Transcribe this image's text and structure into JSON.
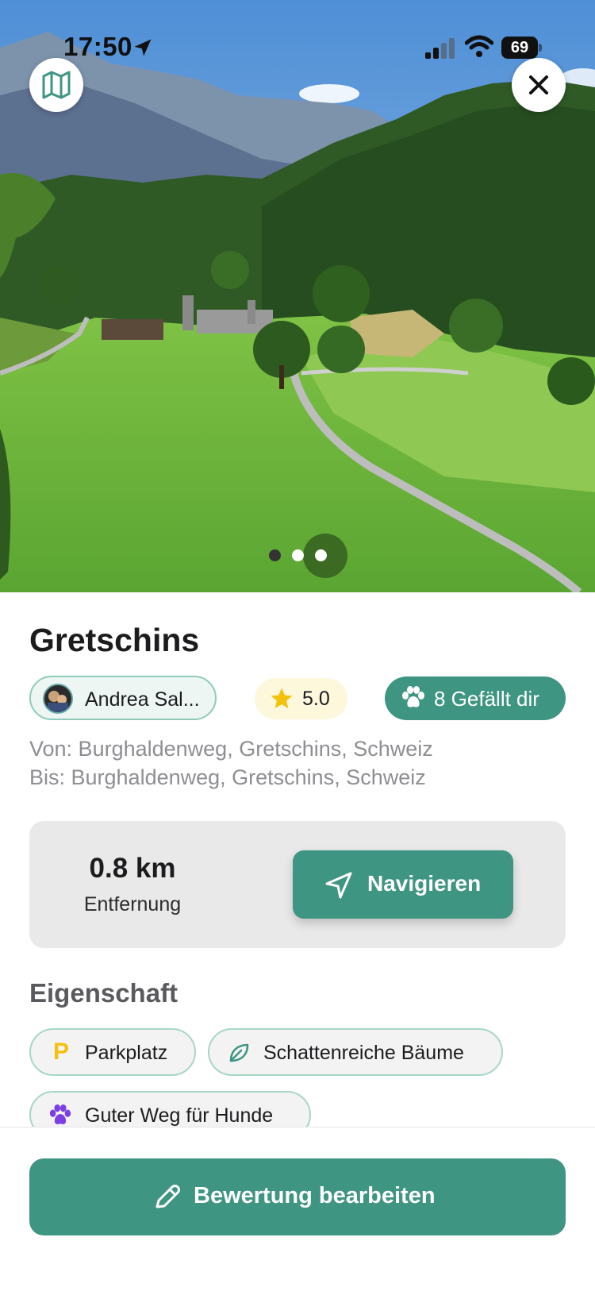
{
  "status_bar": {
    "time": "17:50",
    "battery": "69"
  },
  "hero": {
    "map_button_icon": "map-icon",
    "close_button_icon": "close-icon",
    "page_indicator": {
      "total": 3,
      "active_index": 0
    }
  },
  "place": {
    "title": "Gretschins",
    "author": "Andrea Sal...",
    "rating": "5.0",
    "likes_label": "8 Gefällt dir",
    "from": "Von: Burghaldenweg, Gretschins, Schweiz",
    "to": "Bis: Burghaldenweg, Gretschins, Schweiz"
  },
  "distance_card": {
    "value": "0.8 km",
    "label": "Entfernung",
    "navigate_label": "Navigieren"
  },
  "features": {
    "title": "Eigenschaft",
    "items": [
      {
        "label": "Parkplatz",
        "icon": "parking-icon",
        "color": "#f4c20d"
      },
      {
        "label": "Schattenreiche Bäume",
        "icon": "leaf-icon",
        "color": "#3e9582"
      },
      {
        "label": "Guter Weg für Hunde",
        "icon": "paw-icon",
        "color": "#7b3fe4"
      }
    ]
  },
  "bottom_action": {
    "label": "Bewertung bearbeiten",
    "icon": "pencil-icon"
  },
  "colors": {
    "accent": "#3e9582",
    "chip_border": "#8fcbbb",
    "rating_bg": "#fdf7dc",
    "star": "#f4c20d"
  }
}
